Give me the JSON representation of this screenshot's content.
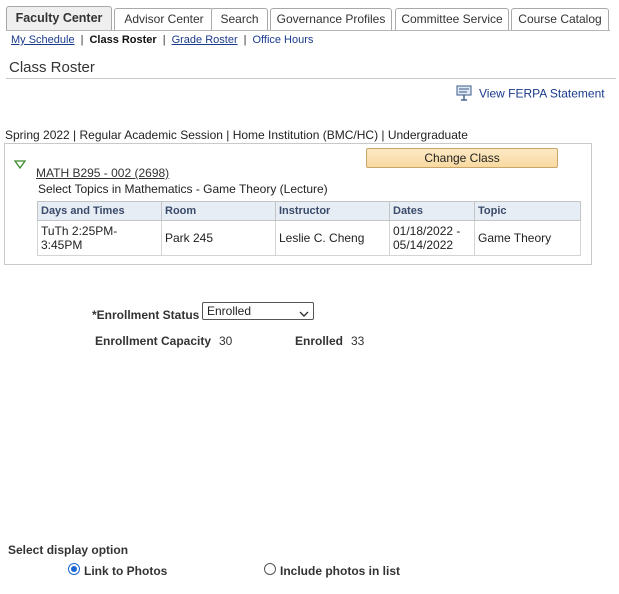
{
  "tabs": [
    {
      "label": "Faculty Center",
      "active": true
    },
    {
      "label": "Advisor Center",
      "active": false
    },
    {
      "label": "Search",
      "active": false
    },
    {
      "label": "Governance Profiles",
      "active": false
    },
    {
      "label": "Committee Service",
      "active": false
    },
    {
      "label": "Course Catalog",
      "active": false
    }
  ],
  "subnav": {
    "my_schedule": "My Schedule",
    "class_roster": "Class Roster",
    "grade_roster": "Grade Roster",
    "office_hours": "Office Hours",
    "separator": "|"
  },
  "page_title": "Class Roster",
  "ferpa_link": "View FERPA Statement",
  "term_line": "Spring 2022 | Regular Academic Session | Home Institution (BMC/HC) | Undergraduate",
  "class": {
    "link": "MATH B295 - 002 (2698)",
    "description": "Select Topics in Mathematics - Game Theory (Lecture)",
    "change_button": "Change Class"
  },
  "meetings": {
    "headers": [
      "Days and Times",
      "Room",
      "Instructor",
      "Dates",
      "Topic"
    ],
    "rows": [
      [
        "TuTh 2:25PM-\n3:45PM",
        "Park 245",
        "Leslie C. Cheng",
        "01/18/2022 -\n05/14/2022",
        "Game Theory"
      ]
    ]
  },
  "enrollment": {
    "status_label": "*Enrollment Status",
    "status_value": "Enrolled",
    "capacity_label": "Enrollment Capacity",
    "capacity_value": "30",
    "enrolled_label": "Enrolled",
    "enrolled_value": "33"
  },
  "display_option": {
    "label": "Select display option",
    "option1": "Link to Photos",
    "option2": "Include photos in list",
    "selected": "Link to Photos"
  },
  "colors": {
    "link": "#1a3b8c",
    "header_bg": "#e7edf4",
    "button_bg": "#fde9c4",
    "triangle": "#3a8a2a",
    "radio_on": "#1a66d2"
  }
}
